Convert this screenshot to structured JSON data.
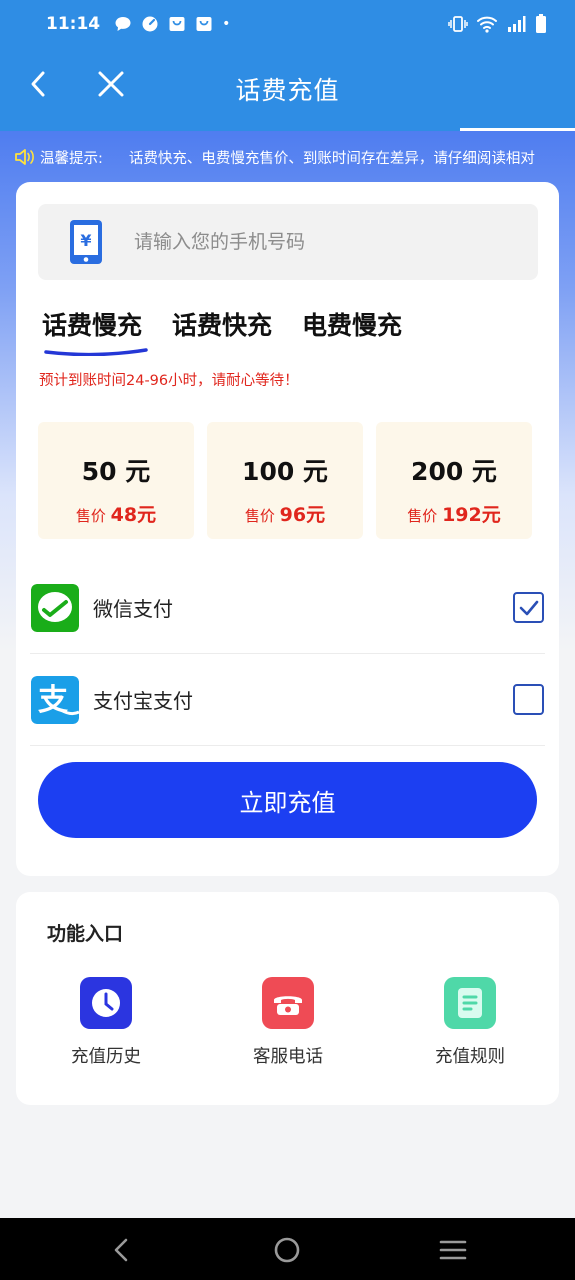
{
  "status_bar": {
    "time": "11:14",
    "dot": "•"
  },
  "header": {
    "title": "话费充值"
  },
  "notice": {
    "label": "温馨提示:",
    "text": "话费快充、电费慢充售价、到账时间存在差异，请仔细阅读相对"
  },
  "phone_input": {
    "placeholder": "请输入您的手机号码",
    "value": ""
  },
  "tabs": [
    {
      "label": "话费慢充",
      "active": true
    },
    {
      "label": "话费快充",
      "active": false
    },
    {
      "label": "电费慢充",
      "active": false
    }
  ],
  "eta_notice": "预计到账时间24-96小时，请耐心等待！",
  "options": [
    {
      "amount": "50 元",
      "price_label": "售价",
      "price": "48元"
    },
    {
      "amount": "100 元",
      "price_label": "售价",
      "price": "96元"
    },
    {
      "amount": "200 元",
      "price_label": "售价",
      "price": "192元"
    }
  ],
  "payment_methods": [
    {
      "name": "微信支付",
      "checked": true,
      "icon": "wechat-pay-icon"
    },
    {
      "name": "支付宝支付",
      "checked": false,
      "icon": "alipay-icon"
    }
  ],
  "submit_label": "立即充值",
  "functions": {
    "title": "功能入口",
    "items": [
      {
        "label": "充值历史",
        "icon": "clock-icon",
        "color": "#2b35e0"
      },
      {
        "label": "客服电话",
        "icon": "telephone-icon",
        "color": "#ef4b55"
      },
      {
        "label": "充值规则",
        "icon": "document-icon",
        "color": "#4fd8a8"
      }
    ]
  },
  "colors": {
    "primary": "#2f8de4",
    "button": "#1c3ff2",
    "price_red": "#e0261d",
    "option_bg": "#fdf7ea"
  }
}
